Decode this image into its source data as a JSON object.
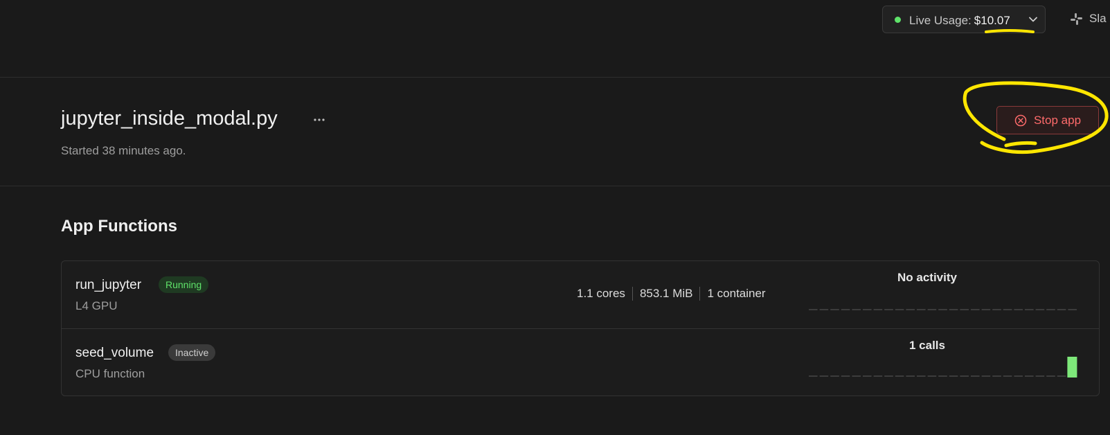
{
  "header": {
    "live_usage": {
      "label": "Live Usage:",
      "amount": "$10.07",
      "status_color": "#5fe36a",
      "icon": "chevron-down-icon"
    },
    "slack": {
      "label": "Sla",
      "icon": "slack-icon"
    }
  },
  "app": {
    "title": "jupyter_inside_modal.py",
    "started": "Started 38 minutes ago.",
    "stop_label": "Stop app",
    "stop_icon": "circle-x-icon",
    "accent_stop": "#ff6b6b"
  },
  "functions": {
    "title": "App Functions",
    "items": [
      {
        "name": "run_jupyter",
        "status": "Running",
        "subtitle": "L4 GPU",
        "stats": [
          "1.1 cores",
          "853.1 MiB",
          "1 container"
        ],
        "activity": "No activity",
        "bars": []
      },
      {
        "name": "seed_volume",
        "status": "Inactive",
        "subtitle": "CPU function",
        "stats": [],
        "activity": "1 calls",
        "bars": [
          {
            "slot": 24,
            "value": 1
          }
        ]
      }
    ]
  },
  "annotation_color": "#ffe600"
}
